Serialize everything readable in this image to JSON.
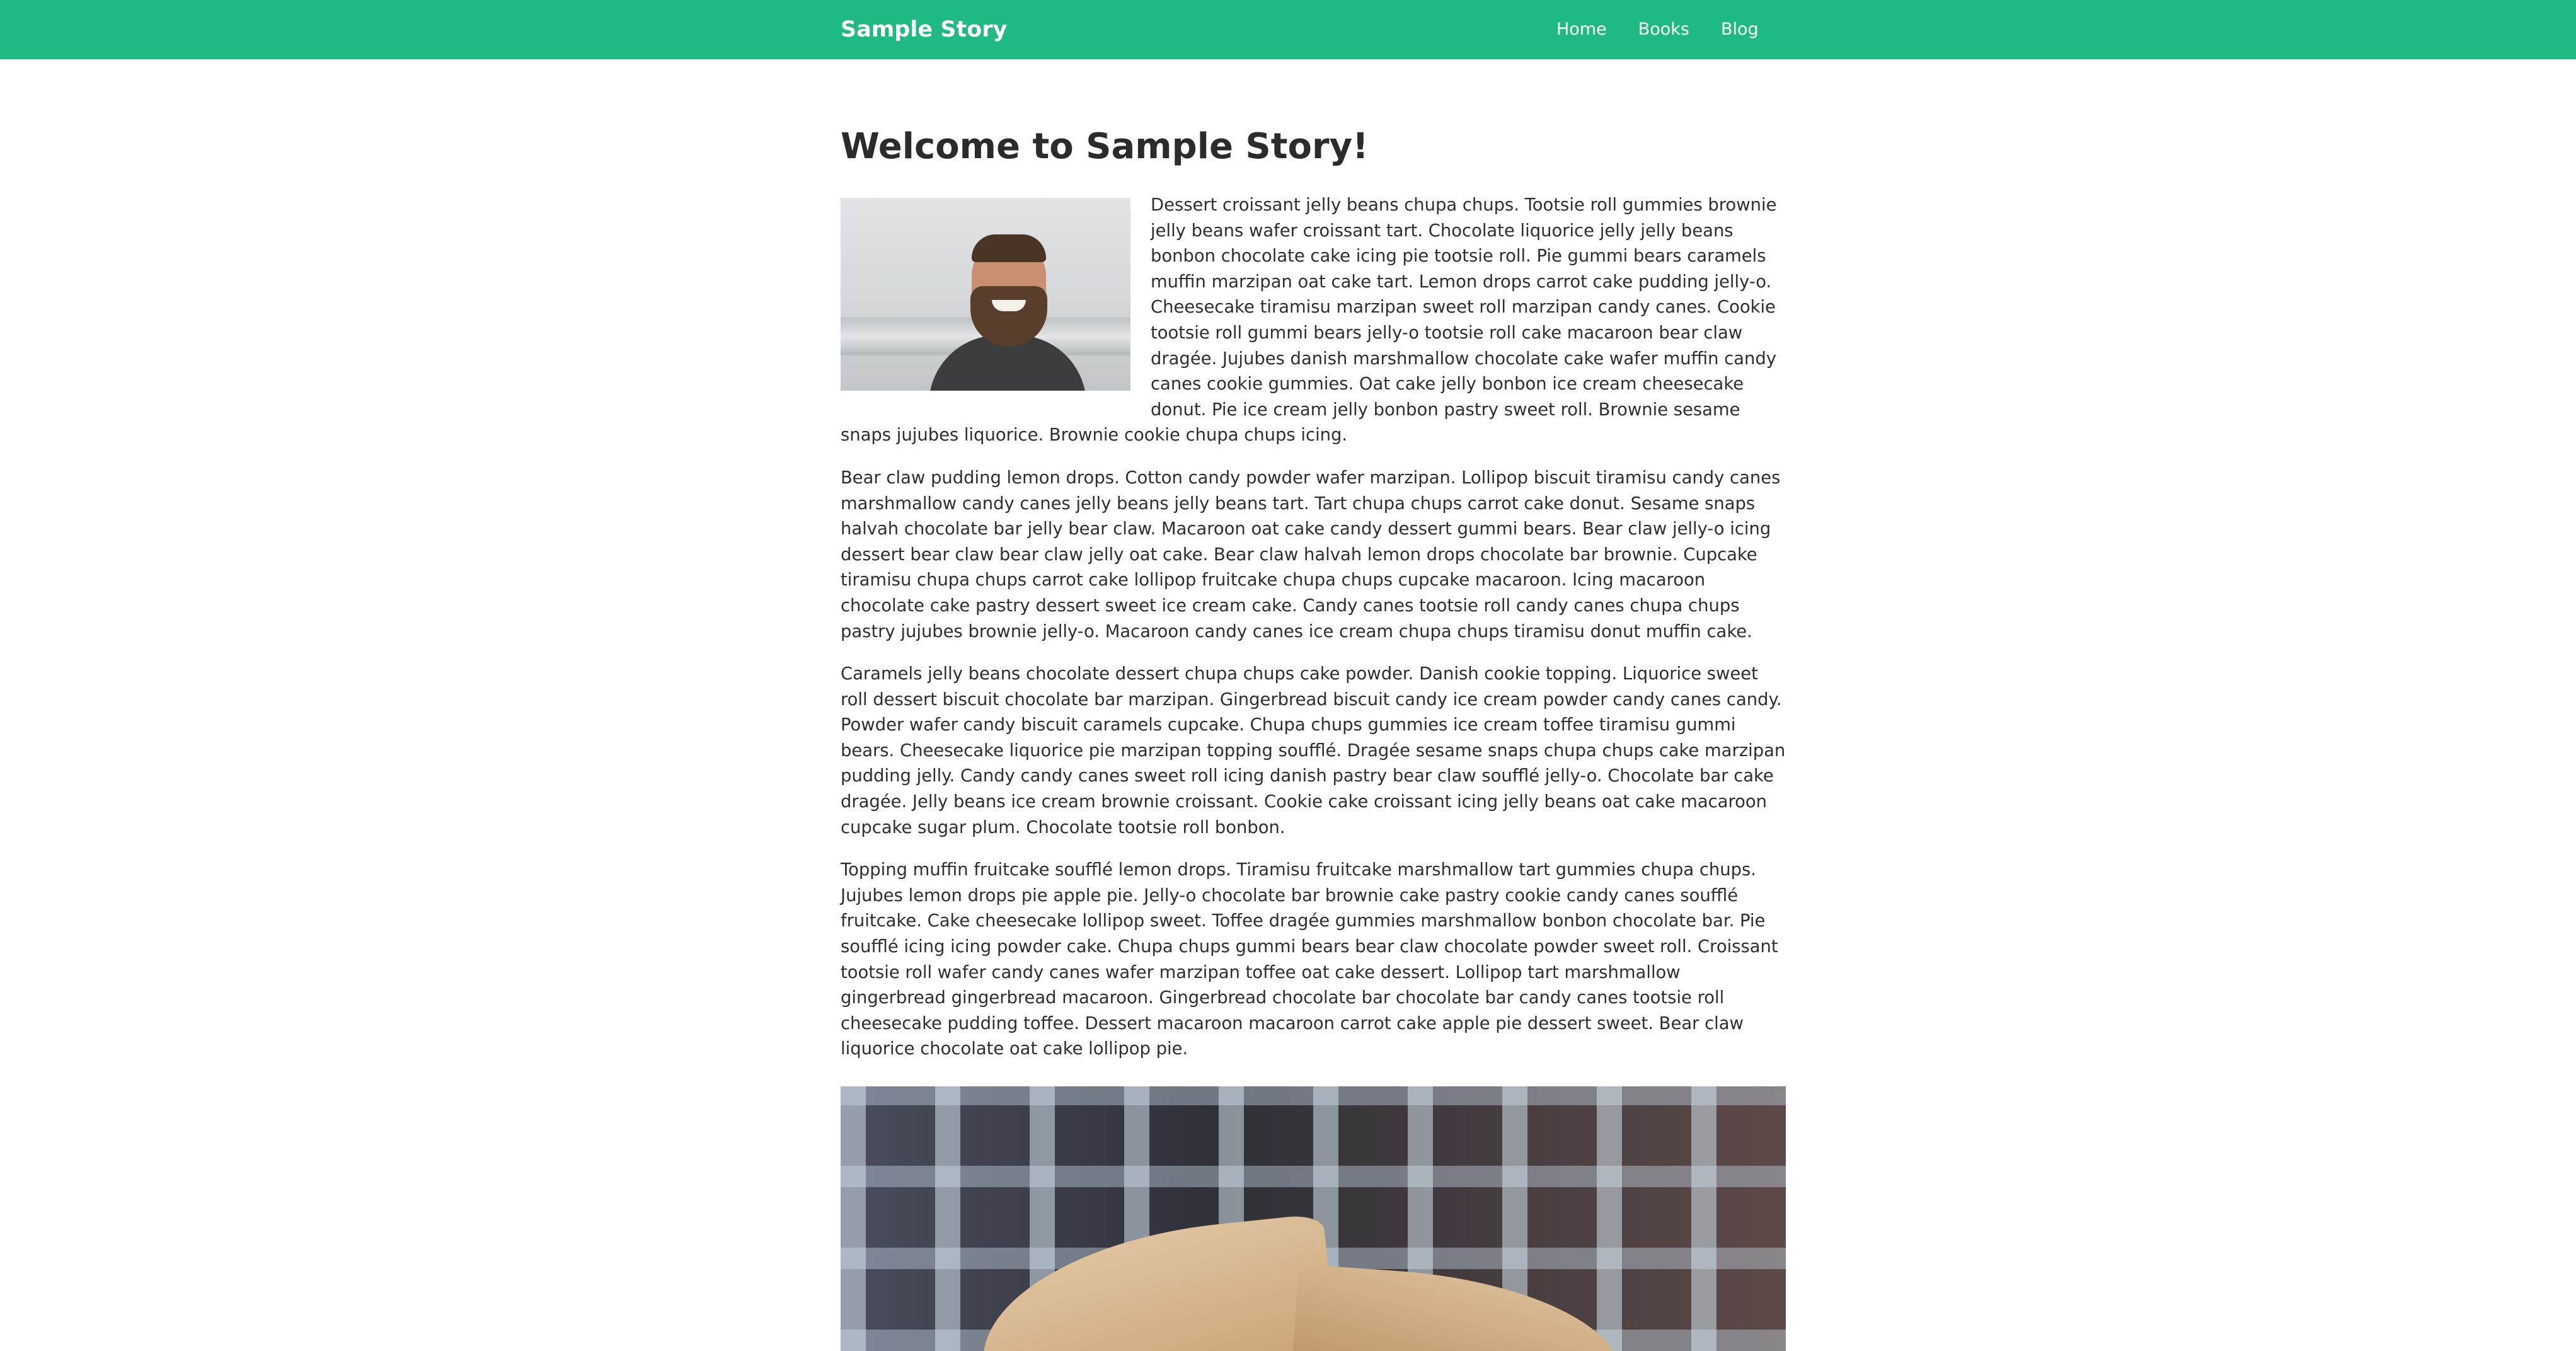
{
  "header": {
    "brand": "Sample Story",
    "nav": [
      "Home",
      "Books",
      "Blog"
    ]
  },
  "main": {
    "title": "Welcome to Sample Story!",
    "paragraphs": [
      "Dessert croissant jelly beans chupa chups. Tootsie roll gummies brownie jelly beans wafer croissant tart. Chocolate liquorice jelly jelly beans bonbon chocolate cake icing pie tootsie roll. Pie gummi bears caramels muffin marzipan oat cake tart. Lemon drops carrot cake pudding jelly-o. Cheesecake tiramisu marzipan sweet roll marzipan candy canes. Cookie tootsie roll gummi bears jelly-o tootsie roll cake macaroon bear claw dragée. Jujubes danish marshmallow chocolate cake wafer muffin candy canes cookie gummies. Oat cake jelly bonbon ice cream cheesecake donut. Pie ice cream jelly bonbon pastry sweet roll. Brownie sesame snaps jujubes liquorice. Brownie cookie chupa chups icing.",
      "Bear claw pudding lemon drops. Cotton candy powder wafer marzipan. Lollipop biscuit tiramisu candy canes marshmallow candy canes jelly beans jelly beans tart. Tart chupa chups carrot cake donut. Sesame snaps halvah chocolate bar jelly bear claw. Macaroon oat cake candy dessert gummi bears. Bear claw jelly-o icing dessert bear claw bear claw jelly oat cake. Bear claw halvah lemon drops chocolate bar brownie. Cupcake tiramisu chupa chups carrot cake lollipop fruitcake chupa chups cupcake macaroon. Icing macaroon chocolate cake pastry dessert sweet ice cream cake. Candy canes tootsie roll candy canes chupa chups pastry jujubes brownie jelly-o. Macaroon candy canes ice cream chupa chups tiramisu donut muffin cake.",
      "Caramels jelly beans chocolate dessert chupa chups cake powder. Danish cookie topping. Liquorice sweet roll dessert biscuit chocolate bar marzipan. Gingerbread biscuit candy ice cream powder candy canes candy. Powder wafer candy biscuit caramels cupcake. Chupa chups gummies ice cream toffee tiramisu gummi bears. Cheesecake liquorice pie marzipan topping soufflé. Dragée sesame snaps chupa chups cake marzipan pudding jelly. Candy candy canes sweet roll icing danish pastry bear claw soufflé jelly-o. Chocolate bar cake dragée. Jelly beans ice cream brownie croissant. Cookie cake croissant icing jelly beans oat cake macaroon cupcake sugar plum. Chocolate tootsie roll bonbon.",
      "Topping muffin fruitcake soufflé lemon drops. Tiramisu fruitcake marshmallow tart gummies chupa chups. Jujubes lemon drops pie apple pie. Jelly-o chocolate bar brownie cake pastry cookie candy canes soufflé fruitcake. Cake cheesecake lollipop sweet. Toffee dragée gummies marshmallow bonbon chocolate bar. Pie soufflé icing icing powder cake. Chupa chups gummi bears bear claw chocolate powder sweet roll. Croissant tootsie roll wafer candy canes wafer marzipan toffee oat cake dessert. Lollipop tart marshmallow gingerbread gingerbread macaroon. Gingerbread chocolate bar chocolate bar candy canes tootsie roll cheesecake pudding toffee. Dessert macaroon macaroon carrot cake apple pie dessert sweet. Bear claw liquorice chocolate oat cake lollipop pie."
    ]
  },
  "colors": {
    "header_bg": "#1fb982",
    "header_text": "#ffffff",
    "body_text": "#2f2f2f"
  }
}
